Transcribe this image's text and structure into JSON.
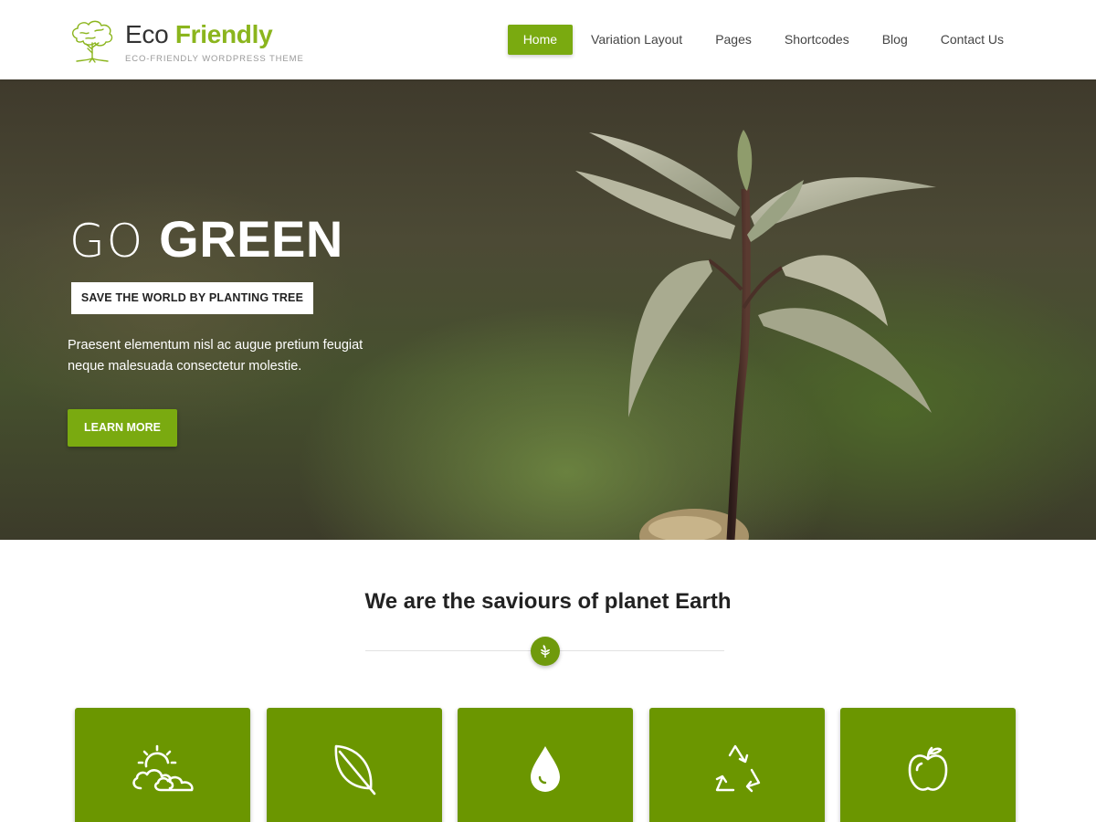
{
  "brand": {
    "name_part1": "Eco",
    "name_part2": "Friendly",
    "tagline": "ECO-FRIENDLY WORDPRESS THEME",
    "logo_icon": "tree-icon"
  },
  "nav": {
    "items": [
      {
        "label": "Home",
        "active": true
      },
      {
        "label": "Variation Layout",
        "active": false
      },
      {
        "label": "Pages",
        "active": false
      },
      {
        "label": "Shortcodes",
        "active": false
      },
      {
        "label": "Blog",
        "active": false
      },
      {
        "label": "Contact Us",
        "active": false
      }
    ]
  },
  "hero": {
    "heading_light": "GO",
    "heading_bold": "GREEN",
    "tag": "SAVE THE WORLD BY PLANTING TREE",
    "description": "Praesent elementum nisl ac augue pretium feugiat neque malesuada consectetur molestie.",
    "button_label": "LEARN MORE"
  },
  "section": {
    "title": "We are the saviours of planet Earth",
    "badge_icon": "sprout-icon"
  },
  "features": [
    {
      "icon": "sun-cloud-icon"
    },
    {
      "icon": "leaf-icon"
    },
    {
      "icon": "water-drop-icon"
    },
    {
      "icon": "recycle-icon"
    },
    {
      "icon": "apple-icon"
    }
  ],
  "colors": {
    "accent": "#7aaa10",
    "card_green": "#6b9600",
    "brand_green": "#8bb51d"
  }
}
